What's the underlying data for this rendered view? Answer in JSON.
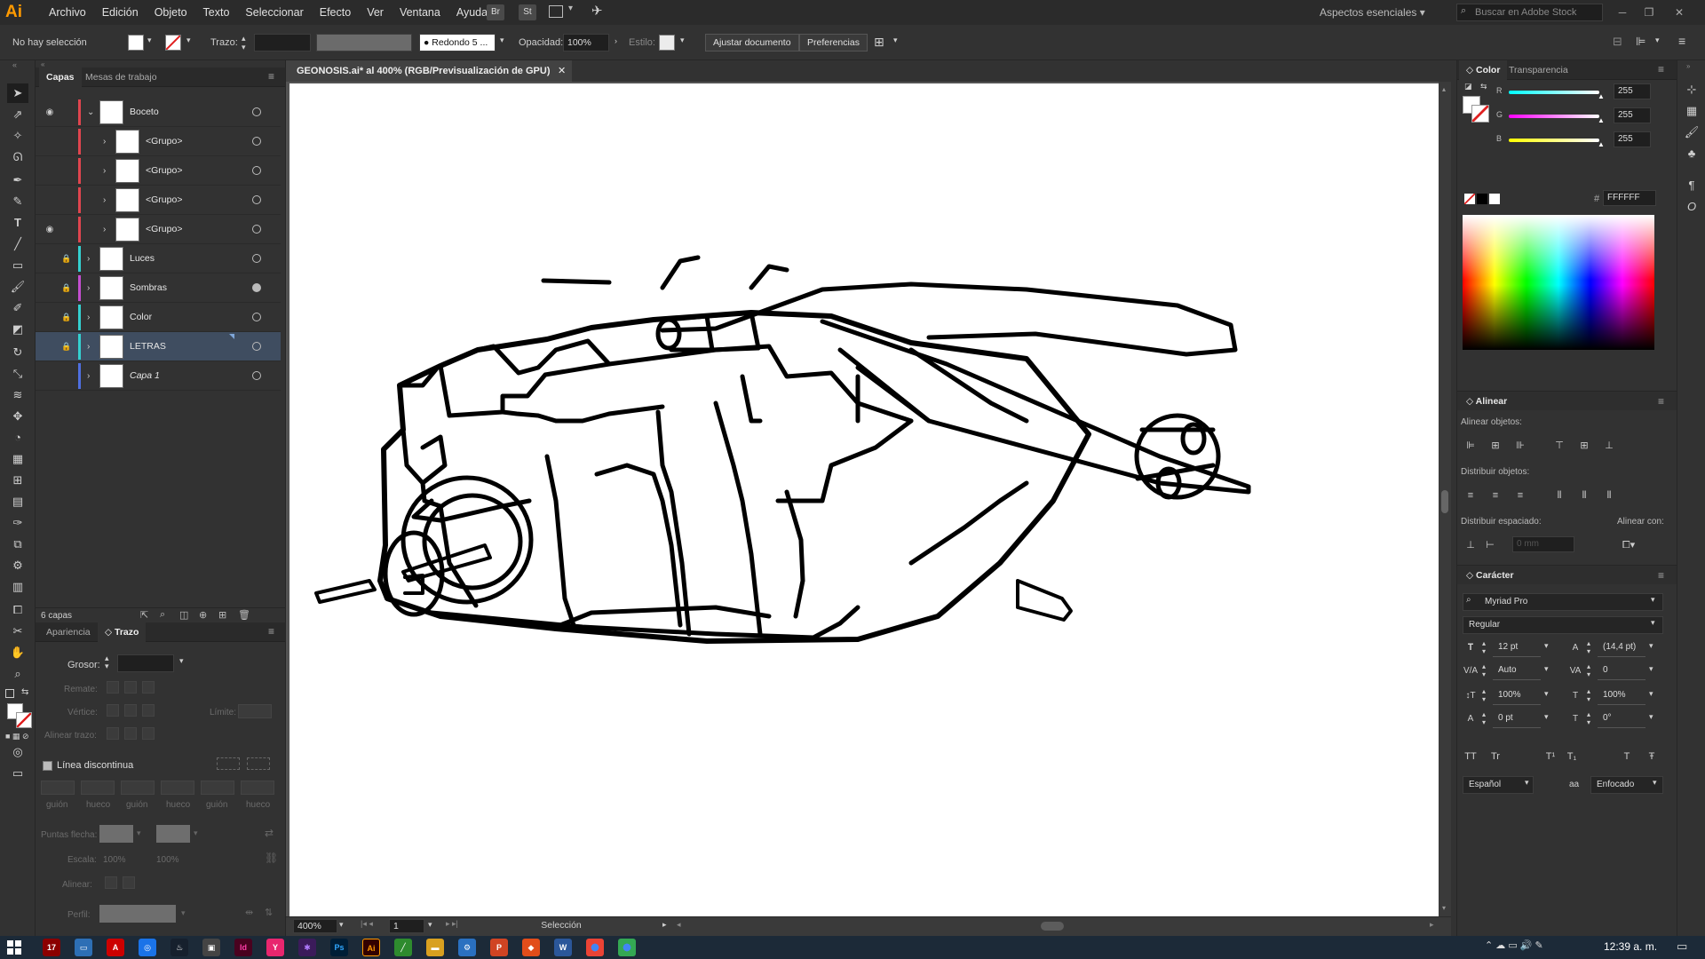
{
  "app": {
    "logo": "Ai"
  },
  "menu": [
    "Archivo",
    "Edición",
    "Objeto",
    "Texto",
    "Seleccionar",
    "Efecto",
    "Ver",
    "Ventana",
    "Ayuda"
  ],
  "bridge_buttons": [
    "Br",
    "St"
  ],
  "workspace": "Aspectos esenciales",
  "stock_search_placeholder": "Buscar en Adobe Stock",
  "control": {
    "selection": "No hay selección",
    "stroke_label": "Trazo:",
    "brush": "Redondo 5 ...",
    "opacity_label": "Opacidad:",
    "opacity": "100%",
    "style_label": "Estilo:",
    "btn_adjust": "Ajustar documento",
    "btn_prefs": "Preferencias"
  },
  "layers_panel": {
    "tabs": [
      "Capas",
      "Mesas de trabajo"
    ],
    "rows": [
      {
        "name": "Boceto",
        "eye": true,
        "lock": false,
        "color": "#e0454f",
        "indent": 0,
        "expanded": true
      },
      {
        "name": "<Grupo>",
        "eye": false,
        "lock": false,
        "color": "#e0454f",
        "indent": 1
      },
      {
        "name": "<Grupo>",
        "eye": false,
        "lock": false,
        "color": "#e0454f",
        "indent": 1
      },
      {
        "name": "<Grupo>",
        "eye": false,
        "lock": false,
        "color": "#e0454f",
        "indent": 1
      },
      {
        "name": "<Grupo>",
        "eye": true,
        "lock": false,
        "color": "#e0454f",
        "indent": 1
      },
      {
        "name": "Luces",
        "eye": false,
        "lock": true,
        "color": "#34d0d0",
        "indent": 0
      },
      {
        "name": "Sombras",
        "eye": false,
        "lock": true,
        "color": "#c44fd0",
        "indent": 0
      },
      {
        "name": "Color",
        "eye": false,
        "lock": true,
        "color": "#34d0d0",
        "indent": 0
      },
      {
        "name": "LETRAS",
        "eye": false,
        "lock": true,
        "color": "#34d0d0",
        "indent": 0,
        "selected": true
      },
      {
        "name": "Capa 1",
        "eye": false,
        "lock": false,
        "color": "#4f6fe0",
        "indent": 0,
        "italic": true
      }
    ],
    "count": "6 capas"
  },
  "stroke_panel": {
    "tabs": [
      "Apariencia",
      "Trazo"
    ],
    "weight_label": "Grosor:",
    "cap_label": "Remate:",
    "corner_label": "Vértice:",
    "limit_label": "Límite:",
    "align_label": "Alinear trazo:",
    "dashed_label": "Línea discontinua",
    "dash_labels": [
      "guión",
      "hueco",
      "guión",
      "hueco",
      "guión",
      "hueco"
    ],
    "arrows_label": "Puntas flecha:",
    "scale_label": "Escala:",
    "scale_values": [
      "100%",
      "100%"
    ],
    "align2_label": "Alinear:",
    "profile_label": "Perfil:"
  },
  "document": {
    "tab": "GEONOSIS.ai* al 400% (RGB/Previsualización de GPU)",
    "zoom": "400%",
    "artboard": "1",
    "status": "Selección"
  },
  "color_panel": {
    "tabs": [
      "Color",
      "Transparencia"
    ],
    "channels": [
      {
        "label": "R",
        "value": "255"
      },
      {
        "label": "G",
        "value": "255"
      },
      {
        "label": "B",
        "value": "255"
      }
    ],
    "hex_label": "#",
    "hex": "FFFFFF"
  },
  "align_panel": {
    "title": "Alinear",
    "align_objects": "Alinear objetos:",
    "distribute_objects": "Distribuir objetos:",
    "distribute_spacing": "Distribuir espaciado:",
    "align_to": "Alinear con:",
    "spacing_value": "0 mm"
  },
  "character_panel": {
    "title": "Carácter",
    "font": "Myriad Pro",
    "style": "Regular",
    "size": "12 pt",
    "leading": "(14,4 pt)",
    "kerning": "Auto",
    "tracking": "0",
    "vscale": "100%",
    "hscale": "100%",
    "baseline": "0 pt",
    "rotation": "0°",
    "language": "Español",
    "aa_label": "aa",
    "antialias": "Enfocado",
    "case_buttons": [
      "TT",
      "Tr",
      "T¹",
      "T₁",
      "T",
      "Ŧ"
    ]
  },
  "taskbar": {
    "time": "12:39 a. m."
  }
}
